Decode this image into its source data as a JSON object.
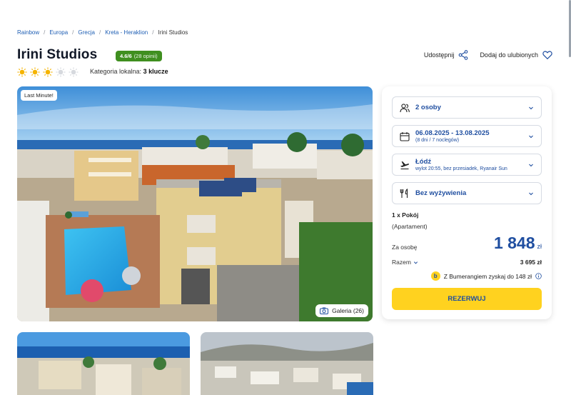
{
  "breadcrumb": [
    "Rainbow",
    "Europa",
    "Grecja",
    "Kreta - Heraklion",
    "Irini Studios"
  ],
  "hotel": {
    "name": "Irini Studios",
    "rating_score": "4.6/6",
    "rating_opinions": "(28 opinii)",
    "suns_filled": 3,
    "suns_total": 5,
    "category_label": "Kategoria lokalna:",
    "category_value": "3 klucze"
  },
  "actions": {
    "share": "Udostępnij",
    "favorite": "Dodaj do ulubionych"
  },
  "photo": {
    "badge": "Last Minute!",
    "gallery": "Galeria (26)"
  },
  "booking": {
    "persons": "2 osoby",
    "dates": "06.08.2025 - 13.08.2025",
    "dates_sub": "(8 dni / 7 noclegów)",
    "departure": "Łódź",
    "departure_sub": "wylot 20:55, bez przesiadek, Ryanair Sun",
    "board": "Bez wyżywienia",
    "room": "1 x Pokój",
    "room_type": "(Apartament)",
    "per_person_label": "Za osobę",
    "price": "1 848",
    "currency": "zł",
    "total_label": "Razem",
    "total_value": "3 695 zł",
    "bumerang": "Z Bumerangiem zyskaj do 148 zł",
    "reserve": "REZERWUJ"
  },
  "colors": {
    "accent": "#1f4ea0",
    "cta": "#ffd21f",
    "rating": "#3f8f1f",
    "sun": "#f5b400"
  }
}
